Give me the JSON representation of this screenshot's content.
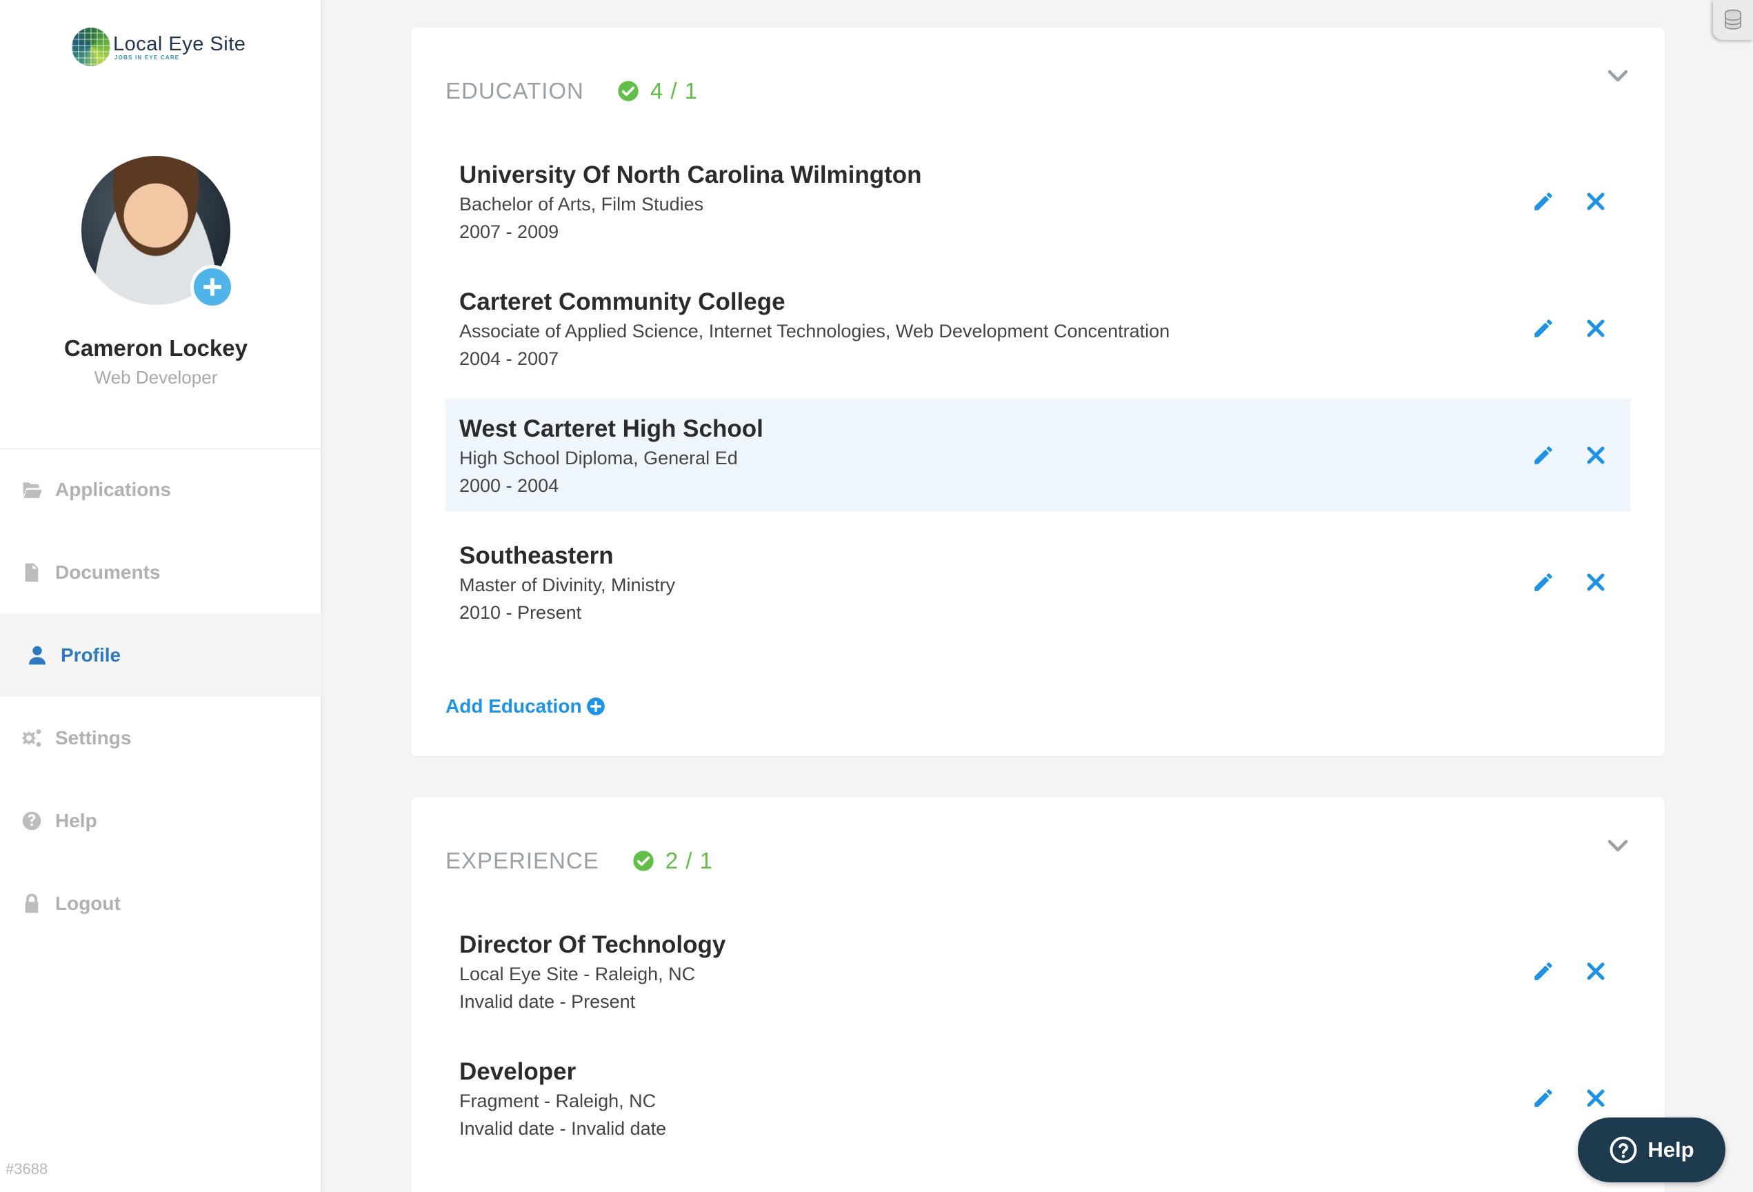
{
  "brand": {
    "name": "Local Eye Site",
    "tagline": "JOBS IN EYE CARE"
  },
  "user": {
    "name": "Cameron Lockey",
    "role": "Web Developer"
  },
  "nav": [
    {
      "label": "Applications",
      "icon": "folder-open-icon",
      "active": false
    },
    {
      "label": "Documents",
      "icon": "document-icon",
      "active": false
    },
    {
      "label": "Profile",
      "icon": "user-icon",
      "active": true
    },
    {
      "label": "Settings",
      "icon": "gears-icon",
      "active": false
    },
    {
      "label": "Help",
      "icon": "question-circle-icon",
      "active": false
    },
    {
      "label": "Logout",
      "icon": "lock-icon",
      "active": false
    }
  ],
  "build": "#3688",
  "education": {
    "title": "EDUCATION",
    "count": "4 / 1",
    "entries": [
      {
        "title": "University Of North Carolina Wilmington",
        "sub": "Bachelor of Arts, Film Studies",
        "dates": "2007 - 2009"
      },
      {
        "title": "Carteret Community College",
        "sub": "Associate of Applied Science, Internet Technologies, Web Development Concentration",
        "dates": "2004 - 2007"
      },
      {
        "title": "West Carteret High School",
        "sub": "High School Diploma, General Ed",
        "dates": "2000 - 2004"
      },
      {
        "title": "Southeastern",
        "sub": "Master of Divinity, Ministry",
        "dates": "2010 - Present"
      }
    ],
    "add_label": "Add Education"
  },
  "experience": {
    "title": "EXPERIENCE",
    "count": "2 / 1",
    "entries": [
      {
        "title": "Director Of Technology",
        "sub": "Local Eye Site - Raleigh, NC",
        "dates": "Invalid date - Present"
      },
      {
        "title": "Developer",
        "sub": "Fragment - Raleigh, NC",
        "dates": "Invalid date - Invalid date"
      }
    ]
  },
  "help_button": {
    "label": "Help"
  },
  "colors": {
    "accent": "#1c93e8",
    "nav_active": "#2c7bc0",
    "success": "#62bf46",
    "highlight_row": "#eef6fc",
    "help_bg": "#1e3a4e"
  }
}
